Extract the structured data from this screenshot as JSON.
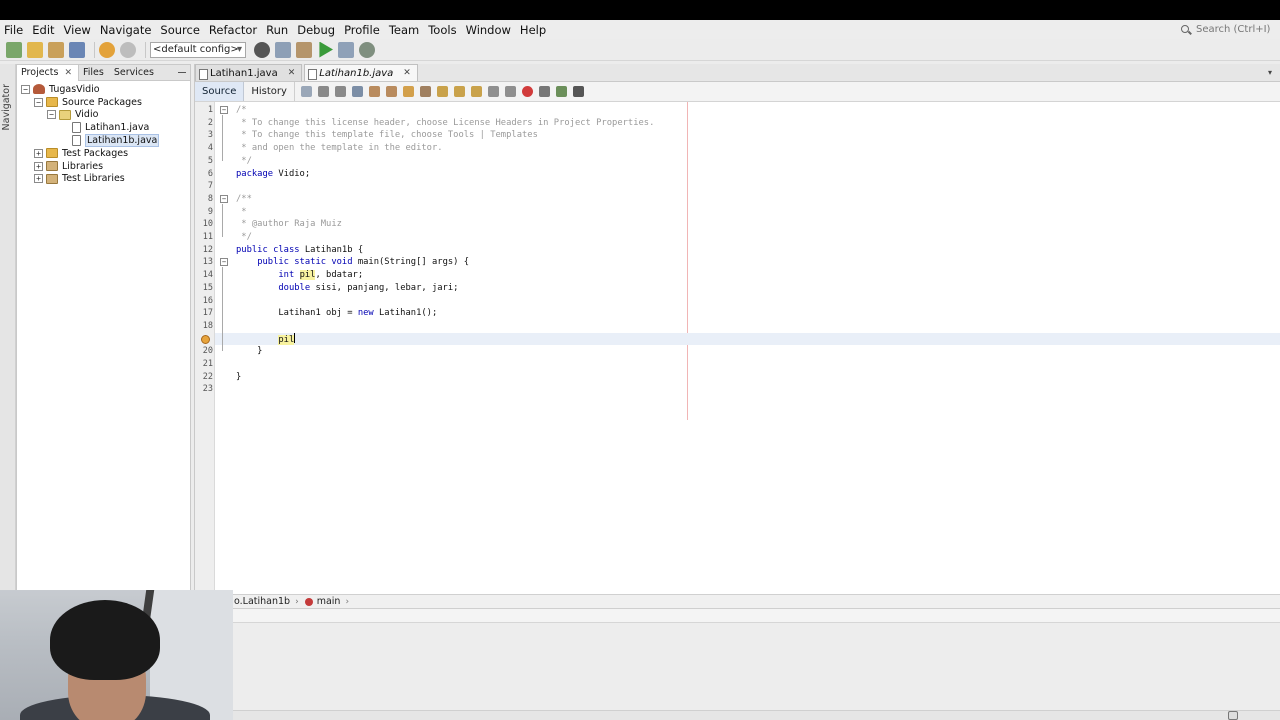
{
  "menu": [
    "File",
    "Edit",
    "View",
    "Navigate",
    "Source",
    "Refactor",
    "Run",
    "Debug",
    "Profile",
    "Team",
    "Tools",
    "Window",
    "Help"
  ],
  "search": {
    "placeholder": "Search (Ctrl+I)"
  },
  "toolbar": {
    "config": "<default config>"
  },
  "navigator_label": "Navigator",
  "projects_panel": {
    "tabs": [
      "Projects",
      "Files",
      "Services"
    ],
    "tree": [
      {
        "label": "TugasVidio",
        "depth": 0,
        "expander": "−",
        "icon": "project"
      },
      {
        "label": "Source Packages",
        "depth": 1,
        "expander": "−",
        "icon": "pkgfolder"
      },
      {
        "label": "Vidio",
        "depth": 2,
        "expander": "−",
        "icon": "pkg"
      },
      {
        "label": "Latihan1.java",
        "depth": 3,
        "expander": "",
        "icon": "file"
      },
      {
        "label": "Latihan1b.java",
        "depth": 3,
        "expander": "",
        "icon": "file",
        "selected": true
      },
      {
        "label": "Test Packages",
        "depth": 1,
        "expander": "+",
        "icon": "pkgfolder"
      },
      {
        "label": "Libraries",
        "depth": 1,
        "expander": "+",
        "icon": "lib"
      },
      {
        "label": "Test Libraries",
        "depth": 1,
        "expander": "+",
        "icon": "lib"
      }
    ]
  },
  "editor": {
    "tabs": [
      {
        "label": "Latihan1.java",
        "active": false
      },
      {
        "label": "Latihan1b.java",
        "active": true
      }
    ],
    "source_label": "Source",
    "history_label": "History",
    "lines": [
      {
        "n": "1",
        "fold": "−",
        "html": "<span class='cmt'>/*</span>"
      },
      {
        "n": "2",
        "html": "<span class='cmt'> * To change this license header, choose License Headers in Project Properties.</span>"
      },
      {
        "n": "3",
        "html": "<span class='cmt'> * To change this template file, choose Tools | Templates</span>"
      },
      {
        "n": "4",
        "html": "<span class='cmt'> * and open the template in the editor.</span>"
      },
      {
        "n": "5",
        "html": "<span class='cmt'> */</span>"
      },
      {
        "n": "6",
        "html": "<span class='kw'>package</span> Vidio;"
      },
      {
        "n": "7",
        "html": ""
      },
      {
        "n": "8",
        "fold": "−",
        "html": "<span class='cmt'>/**</span>"
      },
      {
        "n": "9",
        "html": "<span class='cmt'> *</span>"
      },
      {
        "n": "10",
        "html": "<span class='cmt'> * @author Raja Muiz</span>"
      },
      {
        "n": "11",
        "html": "<span class='cmt'> */</span>"
      },
      {
        "n": "12",
        "html": "<span class='kw'>public class</span> Latihan1b {"
      },
      {
        "n": "13",
        "fold": "−",
        "html": "    <span class='kw'>public static void</span> main(String[] args) {"
      },
      {
        "n": "14",
        "html": "        <span class='kw'>int</span> <span class='hl'>pil</span>, bdatar;"
      },
      {
        "n": "15",
        "html": "        <span class='kw'>double</span> sisi, panjang, lebar, jari;"
      },
      {
        "n": "16",
        "html": ""
      },
      {
        "n": "17",
        "html": "        Latihan1 obj = <span class='kw'>new</span> Latihan1();"
      },
      {
        "n": "18",
        "html": ""
      },
      {
        "n": "",
        "hint": true,
        "current": true,
        "html": "        <span class='hl'>pil</span><span class='caret'></span>"
      },
      {
        "n": "20",
        "html": "    }"
      },
      {
        "n": "21",
        "html": ""
      },
      {
        "n": "22",
        "html": "}"
      },
      {
        "n": "23",
        "html": ""
      }
    ]
  },
  "breadcrumb": [
    {
      "label": "o.Latihan1b",
      "icon": ""
    },
    {
      "label": "main",
      "icon": "method"
    }
  ]
}
